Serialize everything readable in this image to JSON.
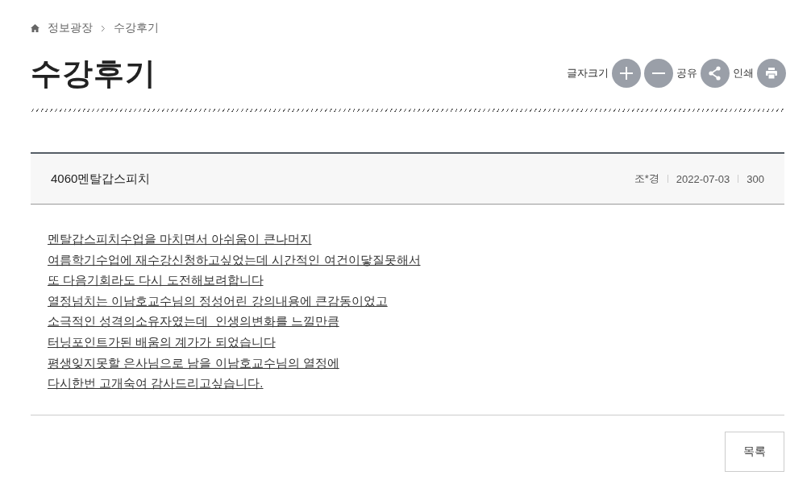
{
  "breadcrumb": [
    "정보광장",
    "수강후기"
  ],
  "page_title": "수강후기",
  "tools": {
    "font_size_label": "글자크기",
    "share_label": "공유",
    "print_label": "인쇄"
  },
  "post": {
    "title": "4060멘탈갑스피치",
    "author": "조*경",
    "date": "2022-07-03",
    "views": "300",
    "body_lines": [
      "멘탈갑스피치수업을 마치면서 아쉬움이 큰나머지",
      "여름학기수업에 재수강신청하고싶었는데 시간적인 여건이닿질못해서",
      "또 다음기회라도 다시 도전해보려합니다",
      "열정넘치는 이남호교수님의 정성어린 강의내용에 큰감동이었고",
      "소극적인 성격의소유자였는데  인생의변화를 느낄만큼",
      "터닝포인트가된 배움의 계가가 되었습니다",
      "평생잊지못할 은사님으로 남을 이남호교수님의 열정에",
      "다시한번 고개숙여 감사드리고싶습니다."
    ]
  },
  "list_button": "목록"
}
